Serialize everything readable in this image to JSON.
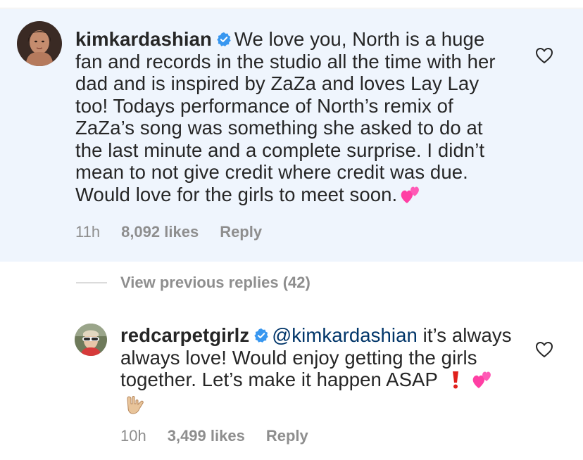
{
  "comment_main": {
    "username": "kimkardashian",
    "text": "We love you, North is a huge fan and records in the studio all the time with her dad and is inspired by ZaZa and loves Lay Lay too! Todays performance of North’s remix of ZaZa’s song was something she asked to do at the last minute and a complete surprise. I didn’t mean to not give credit where credit was due. Would love for the girls to meet soon.",
    "time": "11h",
    "likes": "8,092 likes",
    "reply_label": "Reply",
    "emoji": "two-hearts-emoji"
  },
  "view_replies": {
    "label": "View previous replies (42)"
  },
  "comment_reply": {
    "username": "redcarpetgirlz",
    "mention": "@kimkardashian",
    "text": "it’s always always love! Would enjoy getting the girls together. Let’s make it happen ASAP",
    "time": "10h",
    "likes": "3,499 likes",
    "reply_label": "Reply",
    "emojis": [
      "exclamation-emoji",
      "two-hearts-emoji",
      "love-you-gesture-emoji"
    ]
  },
  "colors": {
    "highlight_bg": "#eff5fd",
    "verified_blue": "#3897f0",
    "muted_text": "#8e8e8e",
    "mention": "#003569"
  }
}
